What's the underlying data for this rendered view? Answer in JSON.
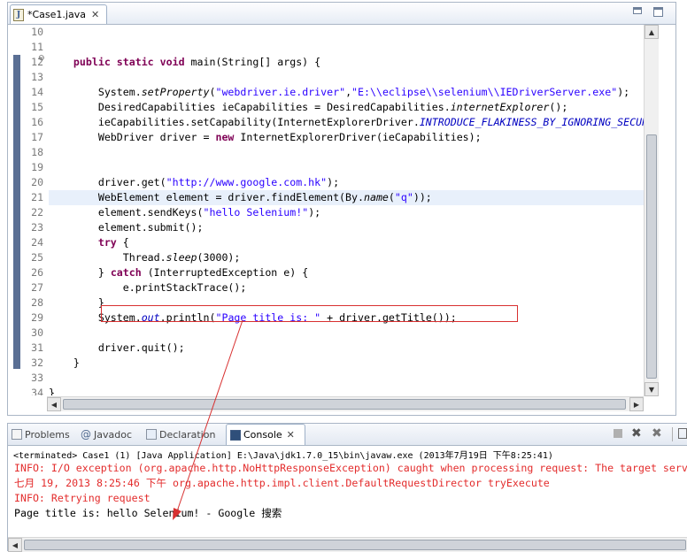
{
  "colors": {
    "keyword": "#7f0055",
    "string": "#2a00ff",
    "field": "#0000c0",
    "error": "#e32c2c",
    "annotation": "#d83030"
  },
  "editor": {
    "tab": {
      "title": "*Case1.java",
      "icon": "java-file-icon",
      "close": "✕"
    },
    "lines": [
      {
        "n": "10",
        "t": []
      },
      {
        "n": "11",
        "t": []
      },
      {
        "n": "12",
        "t": [
          {
            "s": "    "
          },
          {
            "s": "public static void",
            "c": "kw"
          },
          {
            "s": " main(String[] args) {"
          }
        ]
      },
      {
        "n": "13",
        "t": []
      },
      {
        "n": "14",
        "t": [
          {
            "s": "        System."
          },
          {
            "s": "setProperty",
            "c": "ital"
          },
          {
            "s": "("
          },
          {
            "s": "\"webdriver.ie.driver\"",
            "c": "str"
          },
          {
            "s": ","
          },
          {
            "s": "\"E:\\\\eclipse\\\\selenium\\\\IEDriverServer.exe\"",
            "c": "str"
          },
          {
            "s": ");"
          }
        ]
      },
      {
        "n": "15",
        "t": [
          {
            "s": "        DesiredCapabilities ieCapabilities = DesiredCapabilities."
          },
          {
            "s": "internetExplorer",
            "c": "ital"
          },
          {
            "s": "();"
          }
        ]
      },
      {
        "n": "16",
        "t": [
          {
            "s": "        ieCapabilities.setCapability(InternetExplorerDriver."
          },
          {
            "s": "INTRODUCE_FLAKINESS_BY_IGNORING_SECURITY_DOMAINS",
            "c": "fld"
          },
          {
            "s": ", "
          },
          {
            "s": "true",
            "c": "kw"
          },
          {
            "s": ");"
          }
        ]
      },
      {
        "n": "17",
        "t": [
          {
            "s": "        WebDriver driver = "
          },
          {
            "s": "new",
            "c": "kw"
          },
          {
            "s": " InternetExplorerDriver(ieCapabilities);"
          }
        ]
      },
      {
        "n": "18",
        "t": []
      },
      {
        "n": "19",
        "t": []
      },
      {
        "n": "20",
        "t": [
          {
            "s": "        driver.get("
          },
          {
            "s": "\"http://www.google.com.hk\"",
            "c": "str"
          },
          {
            "s": ");"
          }
        ]
      },
      {
        "n": "21",
        "current": true,
        "t": [
          {
            "s": "        WebElement element = driver.findElement(By."
          },
          {
            "s": "name",
            "c": "ital"
          },
          {
            "s": "("
          },
          {
            "s": "\"q\"",
            "c": "str"
          },
          {
            "s": "));"
          }
        ]
      },
      {
        "n": "22",
        "t": [
          {
            "s": "        element.sendKeys("
          },
          {
            "s": "\"hello Selenium!\"",
            "c": "str"
          },
          {
            "s": ");"
          }
        ]
      },
      {
        "n": "23",
        "t": [
          {
            "s": "        element.submit();"
          }
        ]
      },
      {
        "n": "24",
        "t": [
          {
            "s": "        "
          },
          {
            "s": "try",
            "c": "kw"
          },
          {
            "s": " {"
          }
        ]
      },
      {
        "n": "25",
        "t": [
          {
            "s": "            Thread."
          },
          {
            "s": "sleep",
            "c": "ital"
          },
          {
            "s": "(3000);"
          }
        ]
      },
      {
        "n": "26",
        "t": [
          {
            "s": "        } "
          },
          {
            "s": "catch",
            "c": "kw"
          },
          {
            "s": " (InterruptedException e) {"
          }
        ]
      },
      {
        "n": "27",
        "t": [
          {
            "s": "            e.printStackTrace();"
          }
        ]
      },
      {
        "n": "28",
        "t": [
          {
            "s": "        }"
          }
        ]
      },
      {
        "n": "29",
        "t": [
          {
            "s": "        System."
          },
          {
            "s": "out",
            "c": "fld"
          },
          {
            "s": ".println("
          },
          {
            "s": "\"Page title is: \"",
            "c": "str"
          },
          {
            "s": " + driver.getTitle());"
          }
        ]
      },
      {
        "n": "30",
        "t": []
      },
      {
        "n": "31",
        "t": [
          {
            "s": "        driver.quit();"
          }
        ]
      },
      {
        "n": "32",
        "t": [
          {
            "s": "    }"
          }
        ]
      },
      {
        "n": "33",
        "t": []
      },
      {
        "n": "34",
        "t": [
          {
            "s": "}"
          }
        ]
      }
    ]
  },
  "panel": {
    "tabs": {
      "problems": "Problems",
      "javadoc": "Javadoc",
      "declaration": "Declaration",
      "console": "Console"
    },
    "console_header": "<terminated> Case1 (1) [Java Application] E:\\Java\\jdk1.7.0_15\\bin\\javaw.exe (2013年7月19日 下午8:25:41)",
    "console_lines": [
      {
        "cls": "err",
        "text": "INFO: I/O exception (org.apache.http.NoHttpResponseException) caught when processing request: The target server failed to respond"
      },
      {
        "cls": "err",
        "text": "七月 19, 2013 8:25:46 下午 org.apache.http.impl.client.DefaultRequestDirector tryExecute"
      },
      {
        "cls": "err",
        "text": "INFO: Retrying request"
      },
      {
        "cls": "out",
        "text": "Page title is: hello Selenium! - Google 搜索"
      }
    ]
  }
}
